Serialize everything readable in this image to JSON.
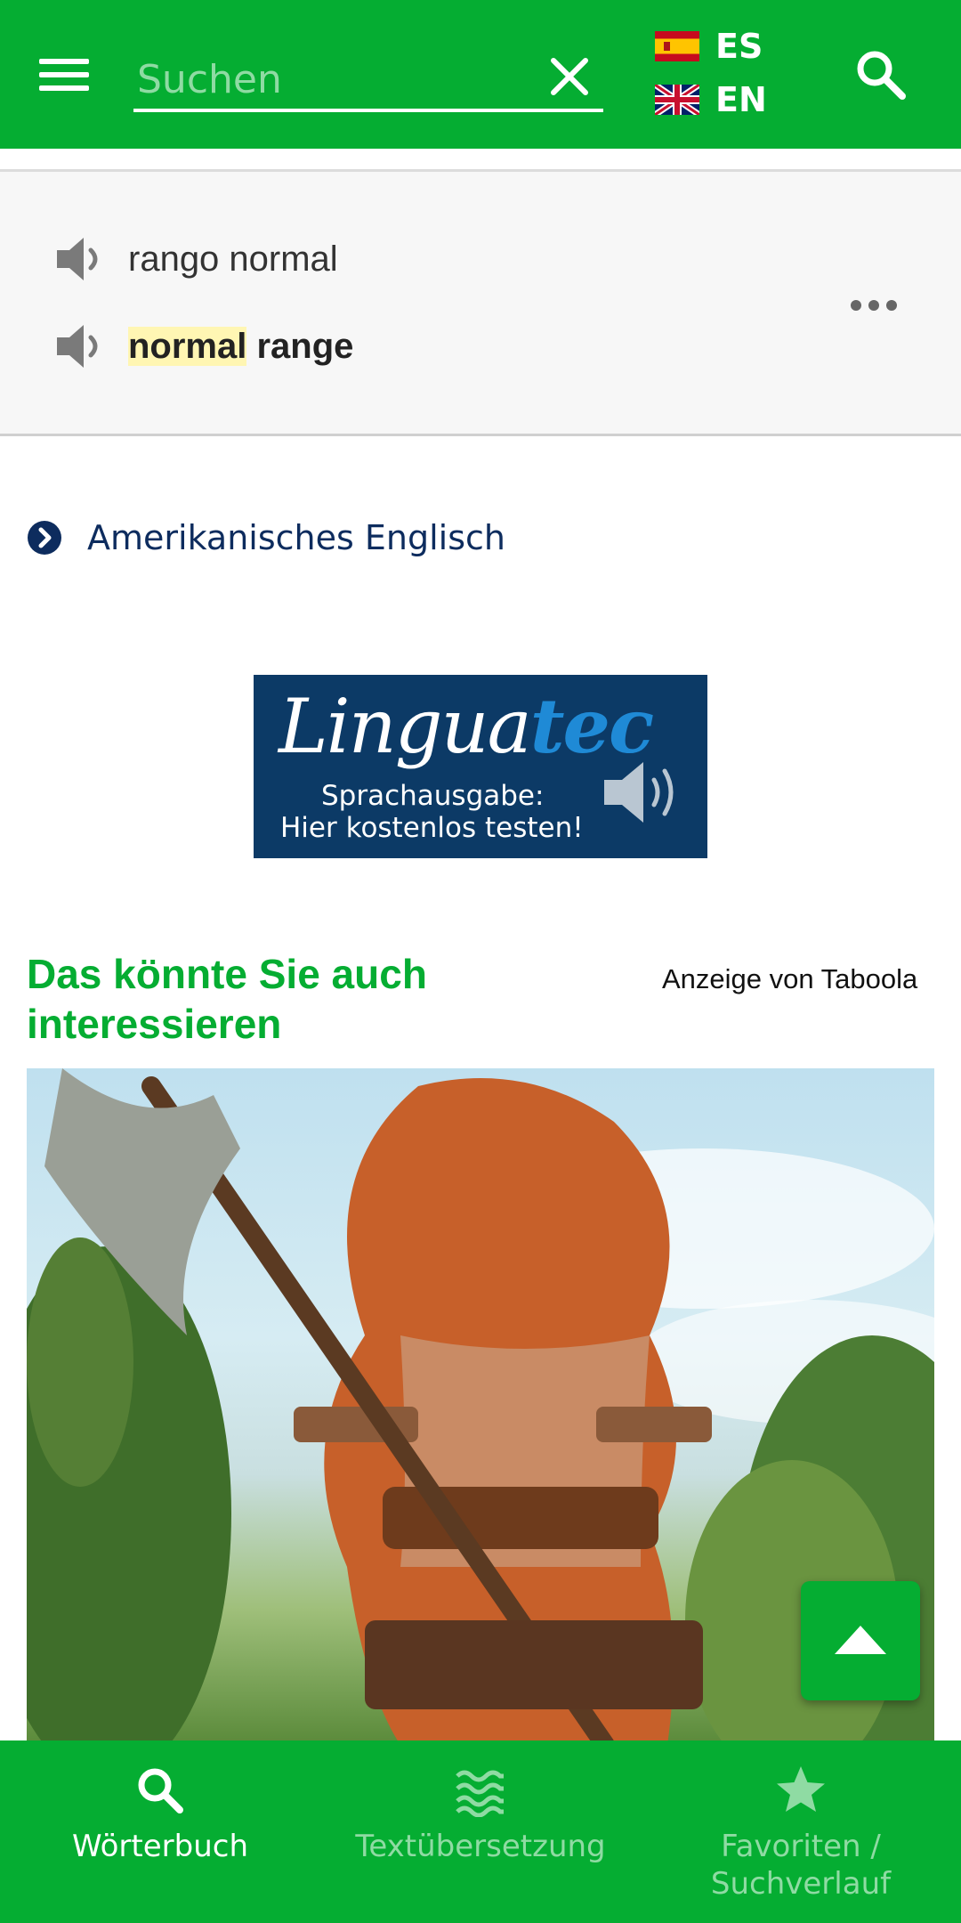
{
  "search": {
    "placeholder": "Suchen"
  },
  "languages": [
    {
      "code": "ES",
      "flag": "spain-flag-icon"
    },
    {
      "code": "EN",
      "flag": "uk-flag-icon"
    }
  ],
  "result": {
    "source_text": "rango normal",
    "target_highlight": "normal",
    "target_rest": " range"
  },
  "variant_link": "Amerikanisches Englisch",
  "ad": {
    "brand_main": "Lingua",
    "brand_accent": "tec",
    "line1": "Sprachausgabe:",
    "line2": "Hier kostenlos testen!"
  },
  "taboola": {
    "title": "Das könnte Sie auch interessieren",
    "attribution": "Anzeige von Taboola"
  },
  "bottom_nav": [
    {
      "label": "Wörterbuch",
      "icon": "search-icon",
      "active": true
    },
    {
      "label": "Textübersetzung",
      "icon": "waves-icon",
      "active": false
    },
    {
      "label": "Favoriten / Suchverlauf",
      "icon": "star-icon",
      "active": false
    }
  ],
  "colors": {
    "brand_green": "#05ad32",
    "inactive_nav": "#8fdba3",
    "link_navy": "#0d2c5e",
    "highlight": "#fff6b3"
  }
}
